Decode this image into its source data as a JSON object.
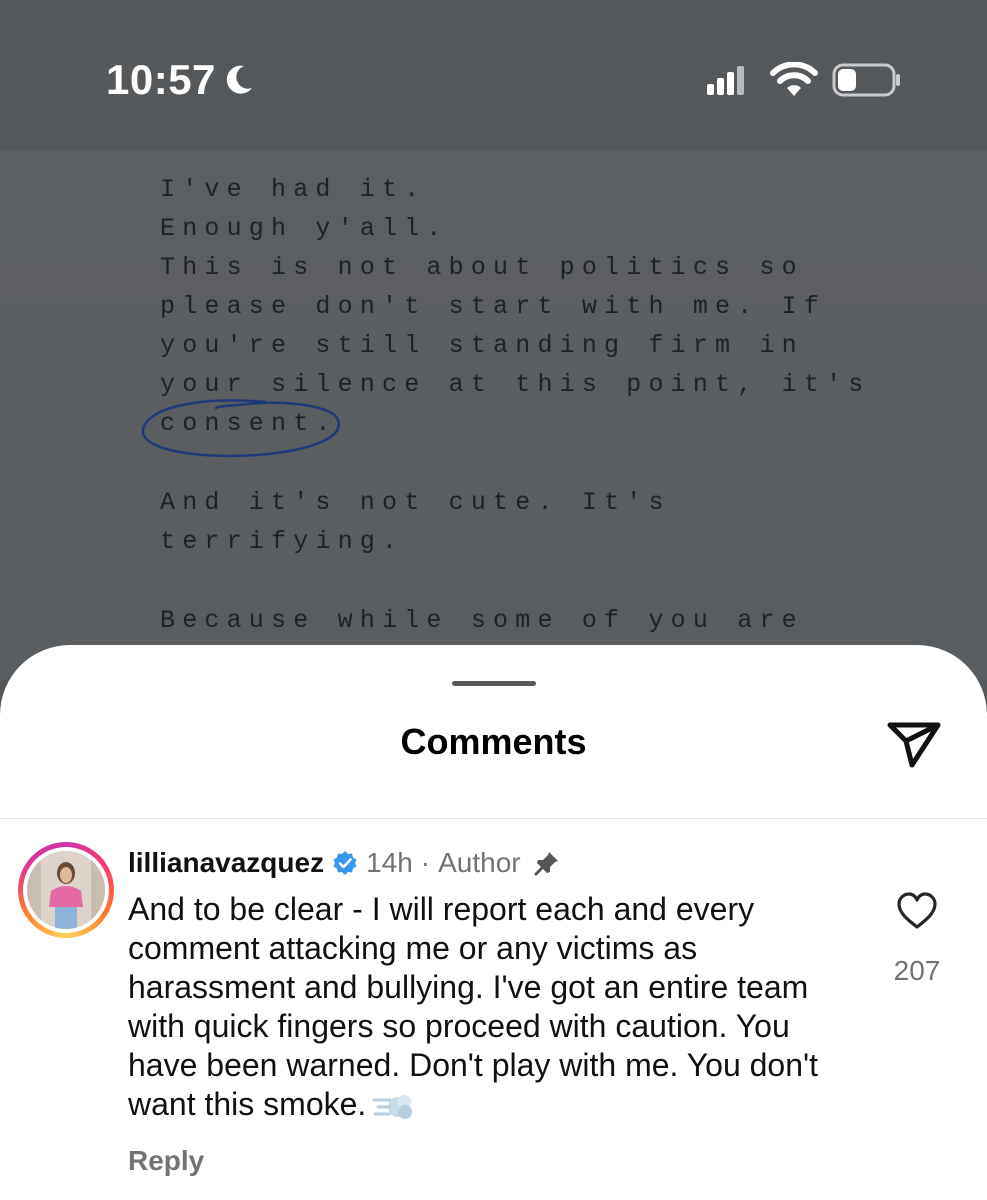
{
  "status_bar": {
    "time": "10:57",
    "focus_icon": "moon-icon",
    "signal_icon": "cellular-signal-icon",
    "wifi_icon": "wifi-icon",
    "battery_icon": "battery-icon",
    "battery_level": 0.35
  },
  "post_image": {
    "lines": [
      "I've had it.",
      "Enough y'all.",
      "This is not about politics so",
      "please don't start with me. If",
      "you're still standing firm in",
      "your silence at this point, it's",
      "consent.",
      "And it's not cute. It's",
      "terrifying.",
      "Because while some of you are"
    ],
    "annotation_icon": "circle-annotation-icon",
    "annotation_color": "#1e3a78"
  },
  "comments_sheet": {
    "title": "Comments",
    "share_icon": "send-icon",
    "comments": [
      {
        "username": "lillianavazquez",
        "verified_icon": "verified-badge-icon",
        "time": "14h",
        "separator": "·",
        "author_label": "Author",
        "pin_icon": "pin-icon",
        "text": "And to be clear - I will report each and every comment attacking me or any victims as harassment and bullying. I've got an entire team with quick fingers so proceed with caution. You have been warned. Don't play with me. You don't want this smoke.",
        "emoji_icon": "dash-smoke-emoji-icon",
        "like_icon": "heart-icon",
        "likes": "207",
        "reply_label": "Reply"
      }
    ]
  },
  "colors": {
    "verified_blue": "#3897f0",
    "meta_gray": "#737373",
    "status_bg": "#55585b"
  }
}
